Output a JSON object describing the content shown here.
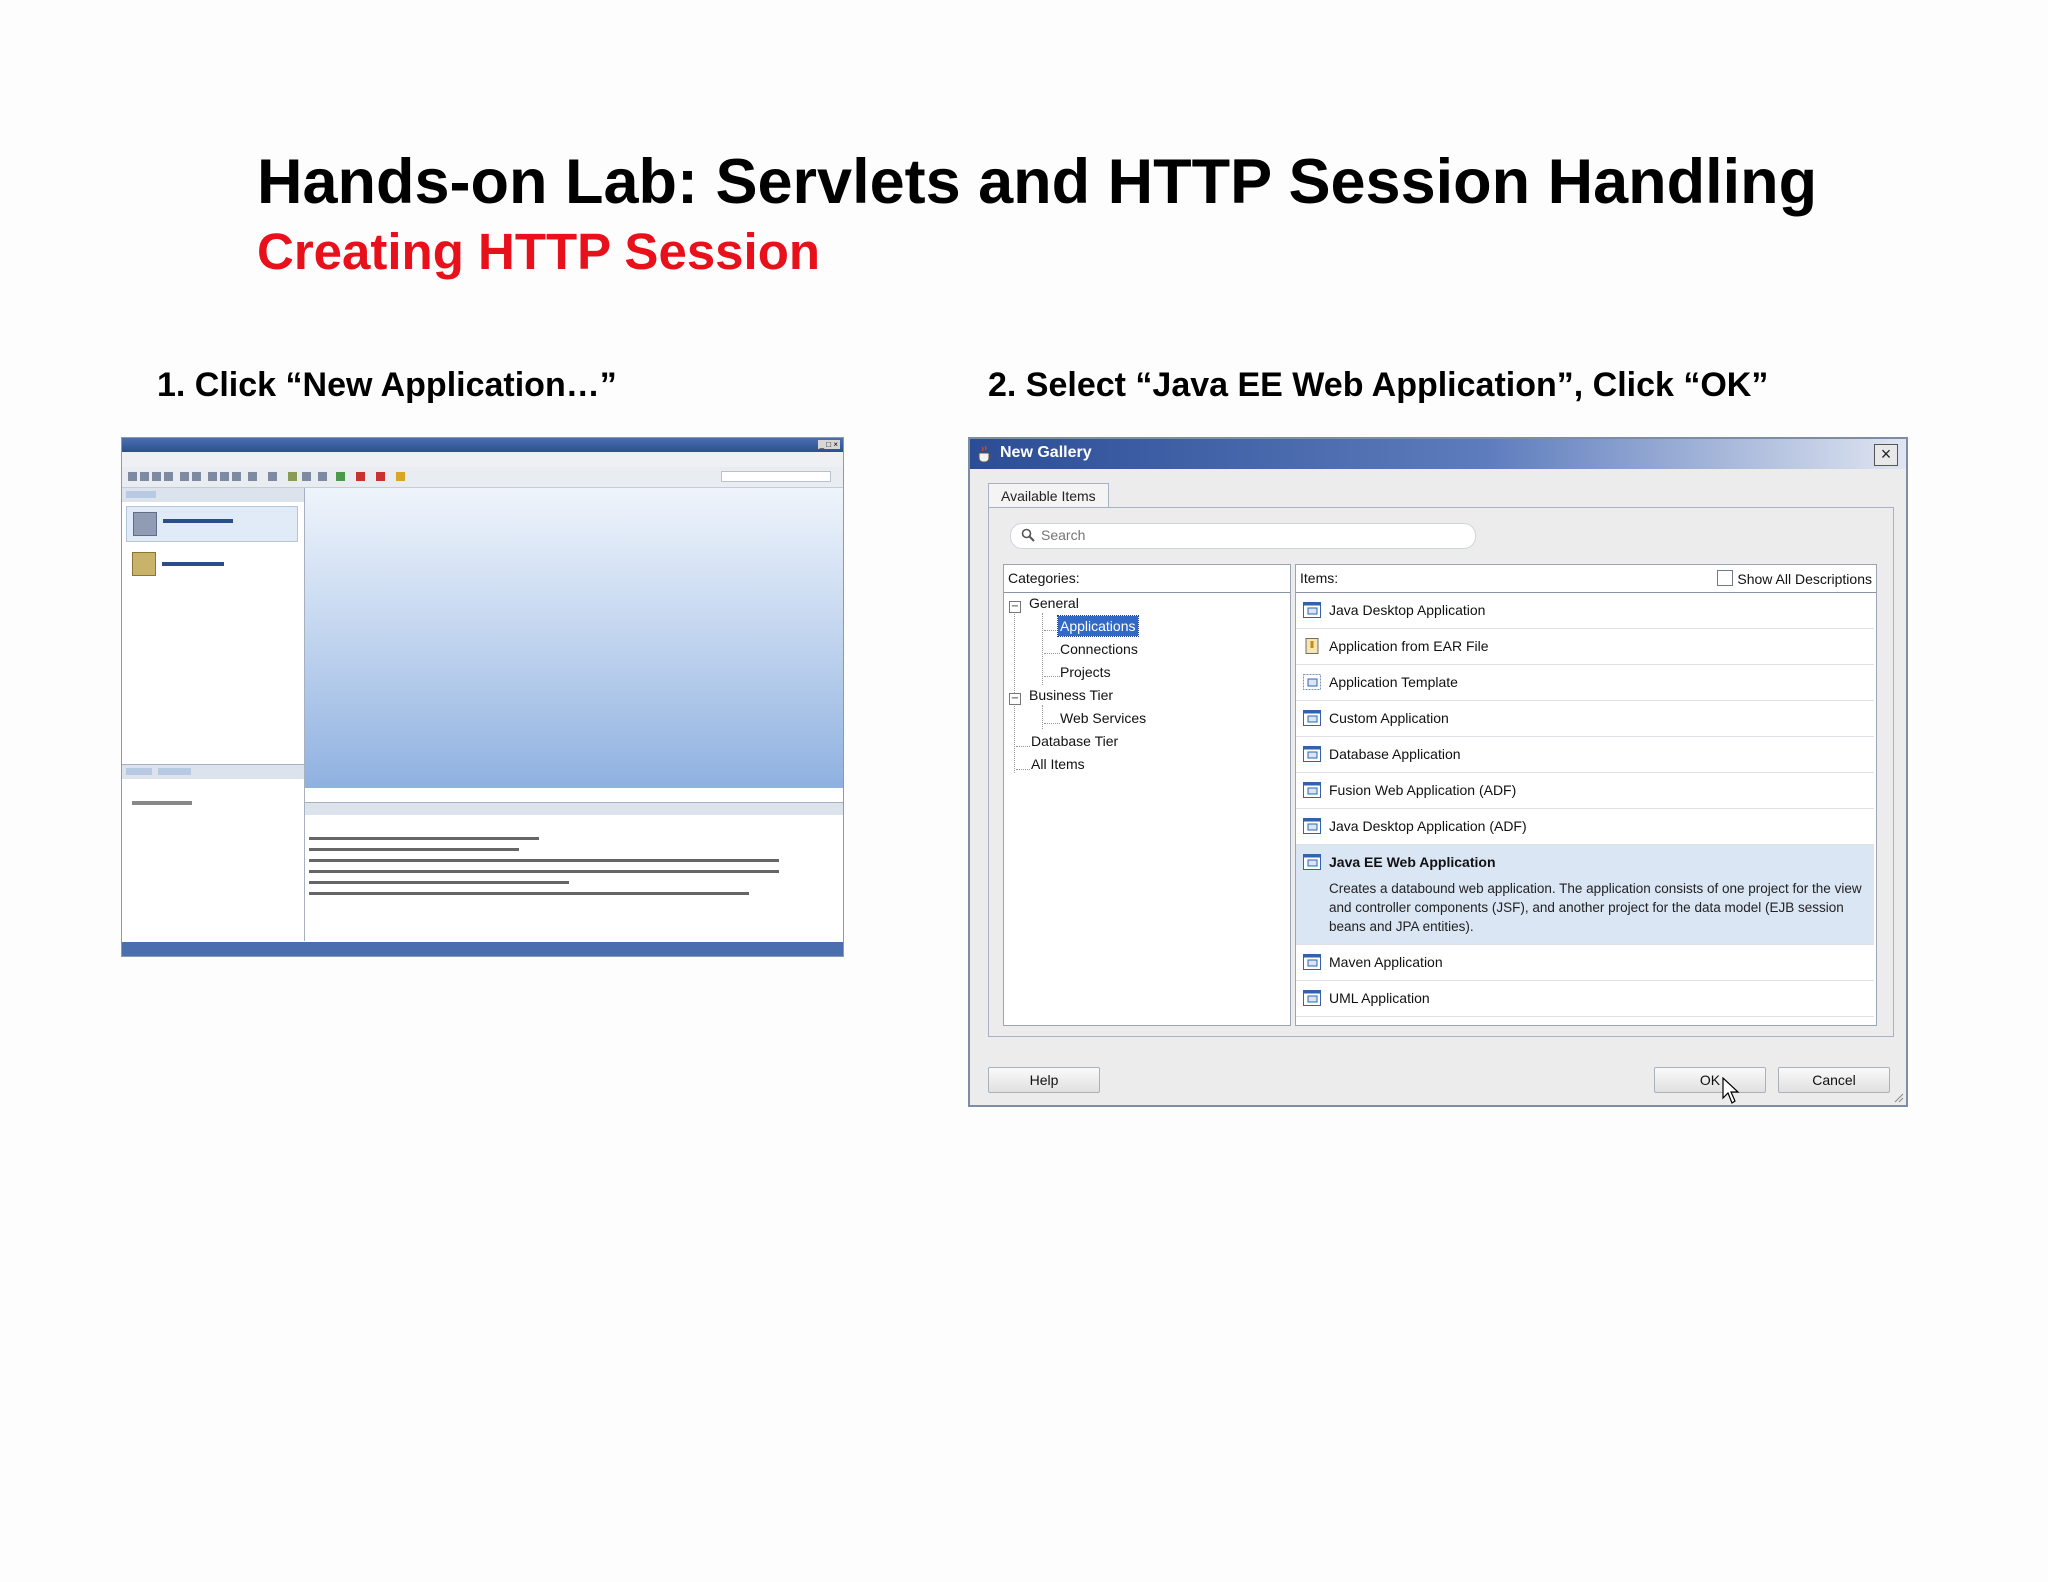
{
  "slide": {
    "title": "Hands-on Lab: Servlets and HTTP Session Handling",
    "subtitle": "Creating HTTP Session",
    "step1": "1. Click “New Application…”",
    "step2": "2. Select “Java EE Web Application”, Click “OK”"
  },
  "colors": {
    "subtitle": "#e8101a",
    "selection": "#3169c6",
    "selected_row": "#dbe6f4",
    "titlebar": "#2b4d95"
  },
  "dialog": {
    "title": "New Gallery",
    "close_icon": "close-icon",
    "tab": "Available Items",
    "search_placeholder": "Search",
    "categories_header": "Categories:",
    "items_header": "Items:",
    "show_all": "Show All Descriptions",
    "show_all_checked": false,
    "categories": [
      {
        "label": "General",
        "expanded": true
      },
      {
        "label": "Applications",
        "selected": true
      },
      {
        "label": "Connections"
      },
      {
        "label": "Projects"
      },
      {
        "label": "Business Tier",
        "expanded": true
      },
      {
        "label": "Web Services"
      },
      {
        "label": "Database Tier"
      },
      {
        "label": "All Items"
      }
    ],
    "items": [
      {
        "label": "Java Desktop Application"
      },
      {
        "label": "Application from EAR File"
      },
      {
        "label": "Application Template"
      },
      {
        "label": "Custom Application"
      },
      {
        "label": "Database Application"
      },
      {
        "label": "Fusion Web Application (ADF)"
      },
      {
        "label": "Java Desktop Application (ADF)"
      },
      {
        "label": "Java EE Web Application",
        "selected": true,
        "description": "Creates a databound web application. The application consists of one project for the view and controller components (JSF), and another project for the data model (EJB session beans and JPA entities)."
      },
      {
        "label": "Maven Application"
      },
      {
        "label": "UML Application"
      }
    ],
    "buttons": {
      "help": "Help",
      "ok": "OK",
      "cancel": "Cancel"
    }
  }
}
